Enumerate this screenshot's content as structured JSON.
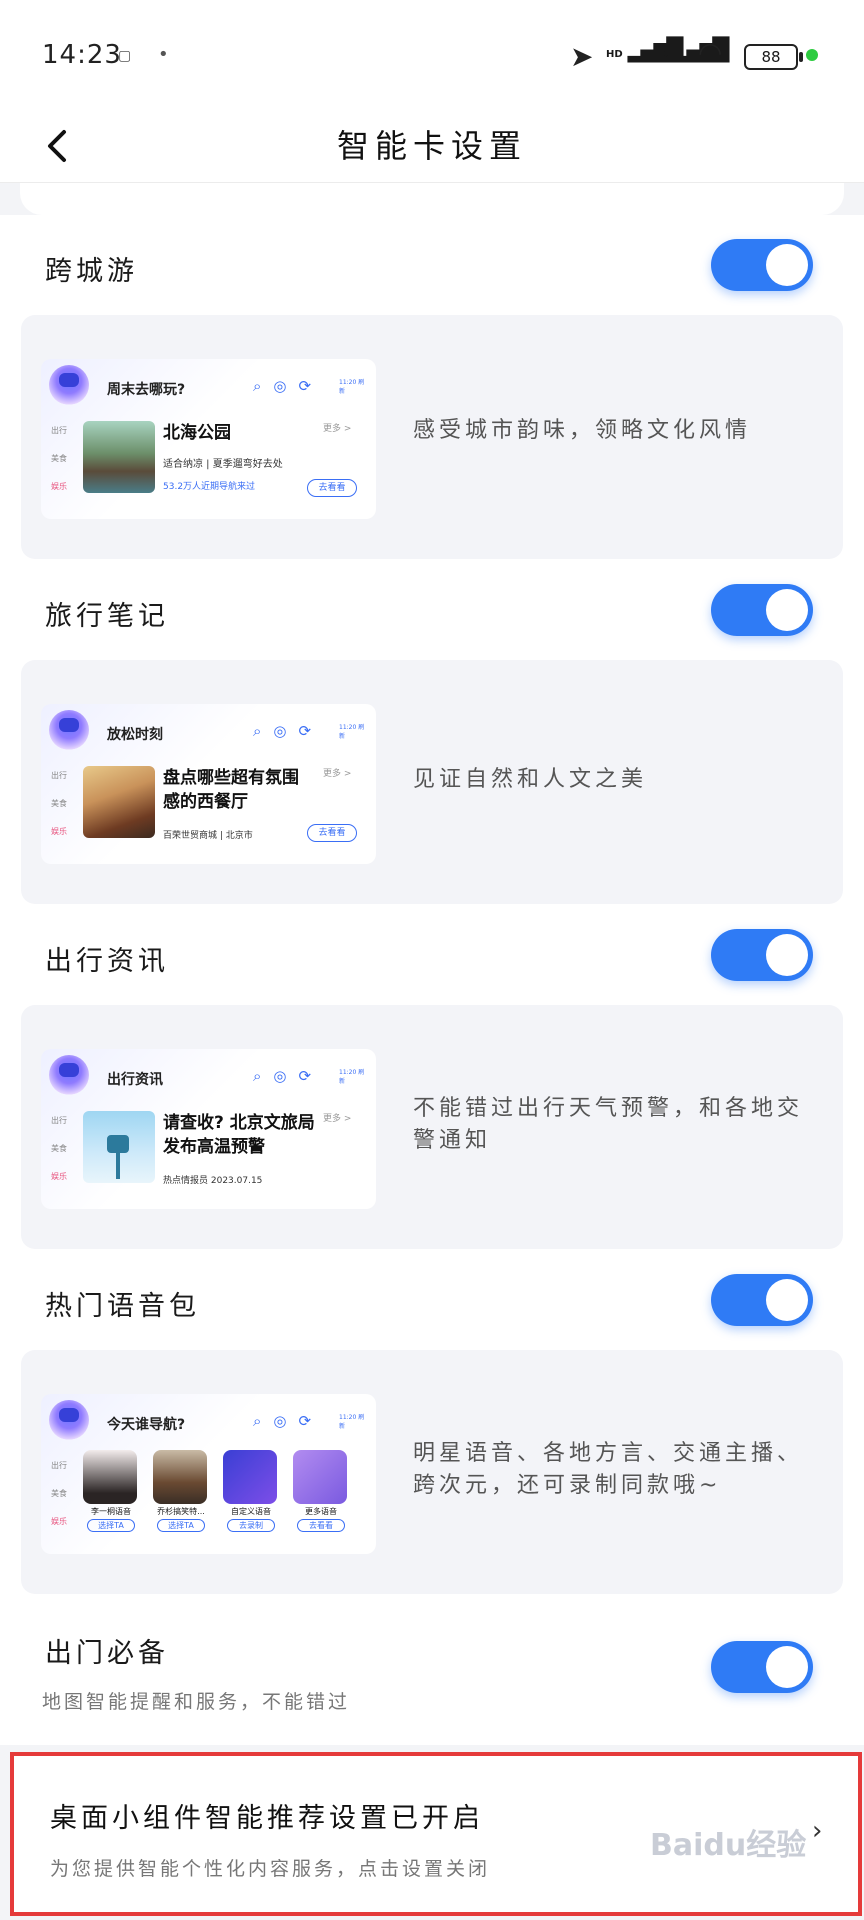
{
  "status": {
    "time": "14:23",
    "battery": "88",
    "hd1": "HD",
    "hd2": "HD"
  },
  "header": {
    "title": "智能卡设置"
  },
  "sections": [
    {
      "title": "跨城游",
      "toggle": true,
      "card": {
        "title": "周末去哪玩?",
        "head": "北海公园",
        "sub": "适合纳凉 | 夏季遛弯好去处",
        "blue": "53.2万人近期导航来过",
        "pill": "去看看",
        "more": "更多 >"
      },
      "desc": "感受城市韵味，领略文化风情"
    },
    {
      "title": "旅行笔记",
      "toggle": true,
      "card": {
        "title": "放松时刻",
        "head": "盘点哪些超有氛围感的西餐厅",
        "sub": "百荣世贸商城 | 北京市",
        "pill": "去看看",
        "more": "更多 >"
      },
      "desc": "见证自然和人文之美"
    },
    {
      "title": "出行资讯",
      "toggle": true,
      "card": {
        "title": "出行资讯",
        "head": "请查收? 北京文旅局发布高温预警",
        "sub": "热点情报员  2023.07.15",
        "more": "更多 >"
      },
      "desc": "不能错过出行天气预警，和各地交警通知"
    },
    {
      "title": "热门语音包",
      "toggle": true,
      "card": {
        "title": "今天谁导航?",
        "voices": [
          {
            "name": "李一桐语音",
            "btn": "选择TA"
          },
          {
            "name": "乔杉搞笑特...",
            "btn": "选择TA"
          },
          {
            "name": "自定义语音",
            "btn": "去录制"
          },
          {
            "name": "更多语音",
            "btn": "去看看"
          }
        ]
      },
      "desc": "明星语音、各地方言、交通主播、跨次元，还可录制同款哦~"
    }
  ],
  "card_side": [
    "出行",
    "美食",
    "娱乐"
  ],
  "card_time": "11:20 刷新",
  "outdoor": {
    "title": "出门必备",
    "toggle": true,
    "sub": "地图智能提醒和服务，不能错过"
  },
  "widget": {
    "title": "桌面小组件智能推荐设置已开启",
    "sub": "为您提供智能个性化内容服务，点击设置关闭"
  },
  "watermark": "Baidu经验",
  "colors": {
    "accent": "#2f7bf5",
    "highlight_border": "#e53a3a"
  }
}
